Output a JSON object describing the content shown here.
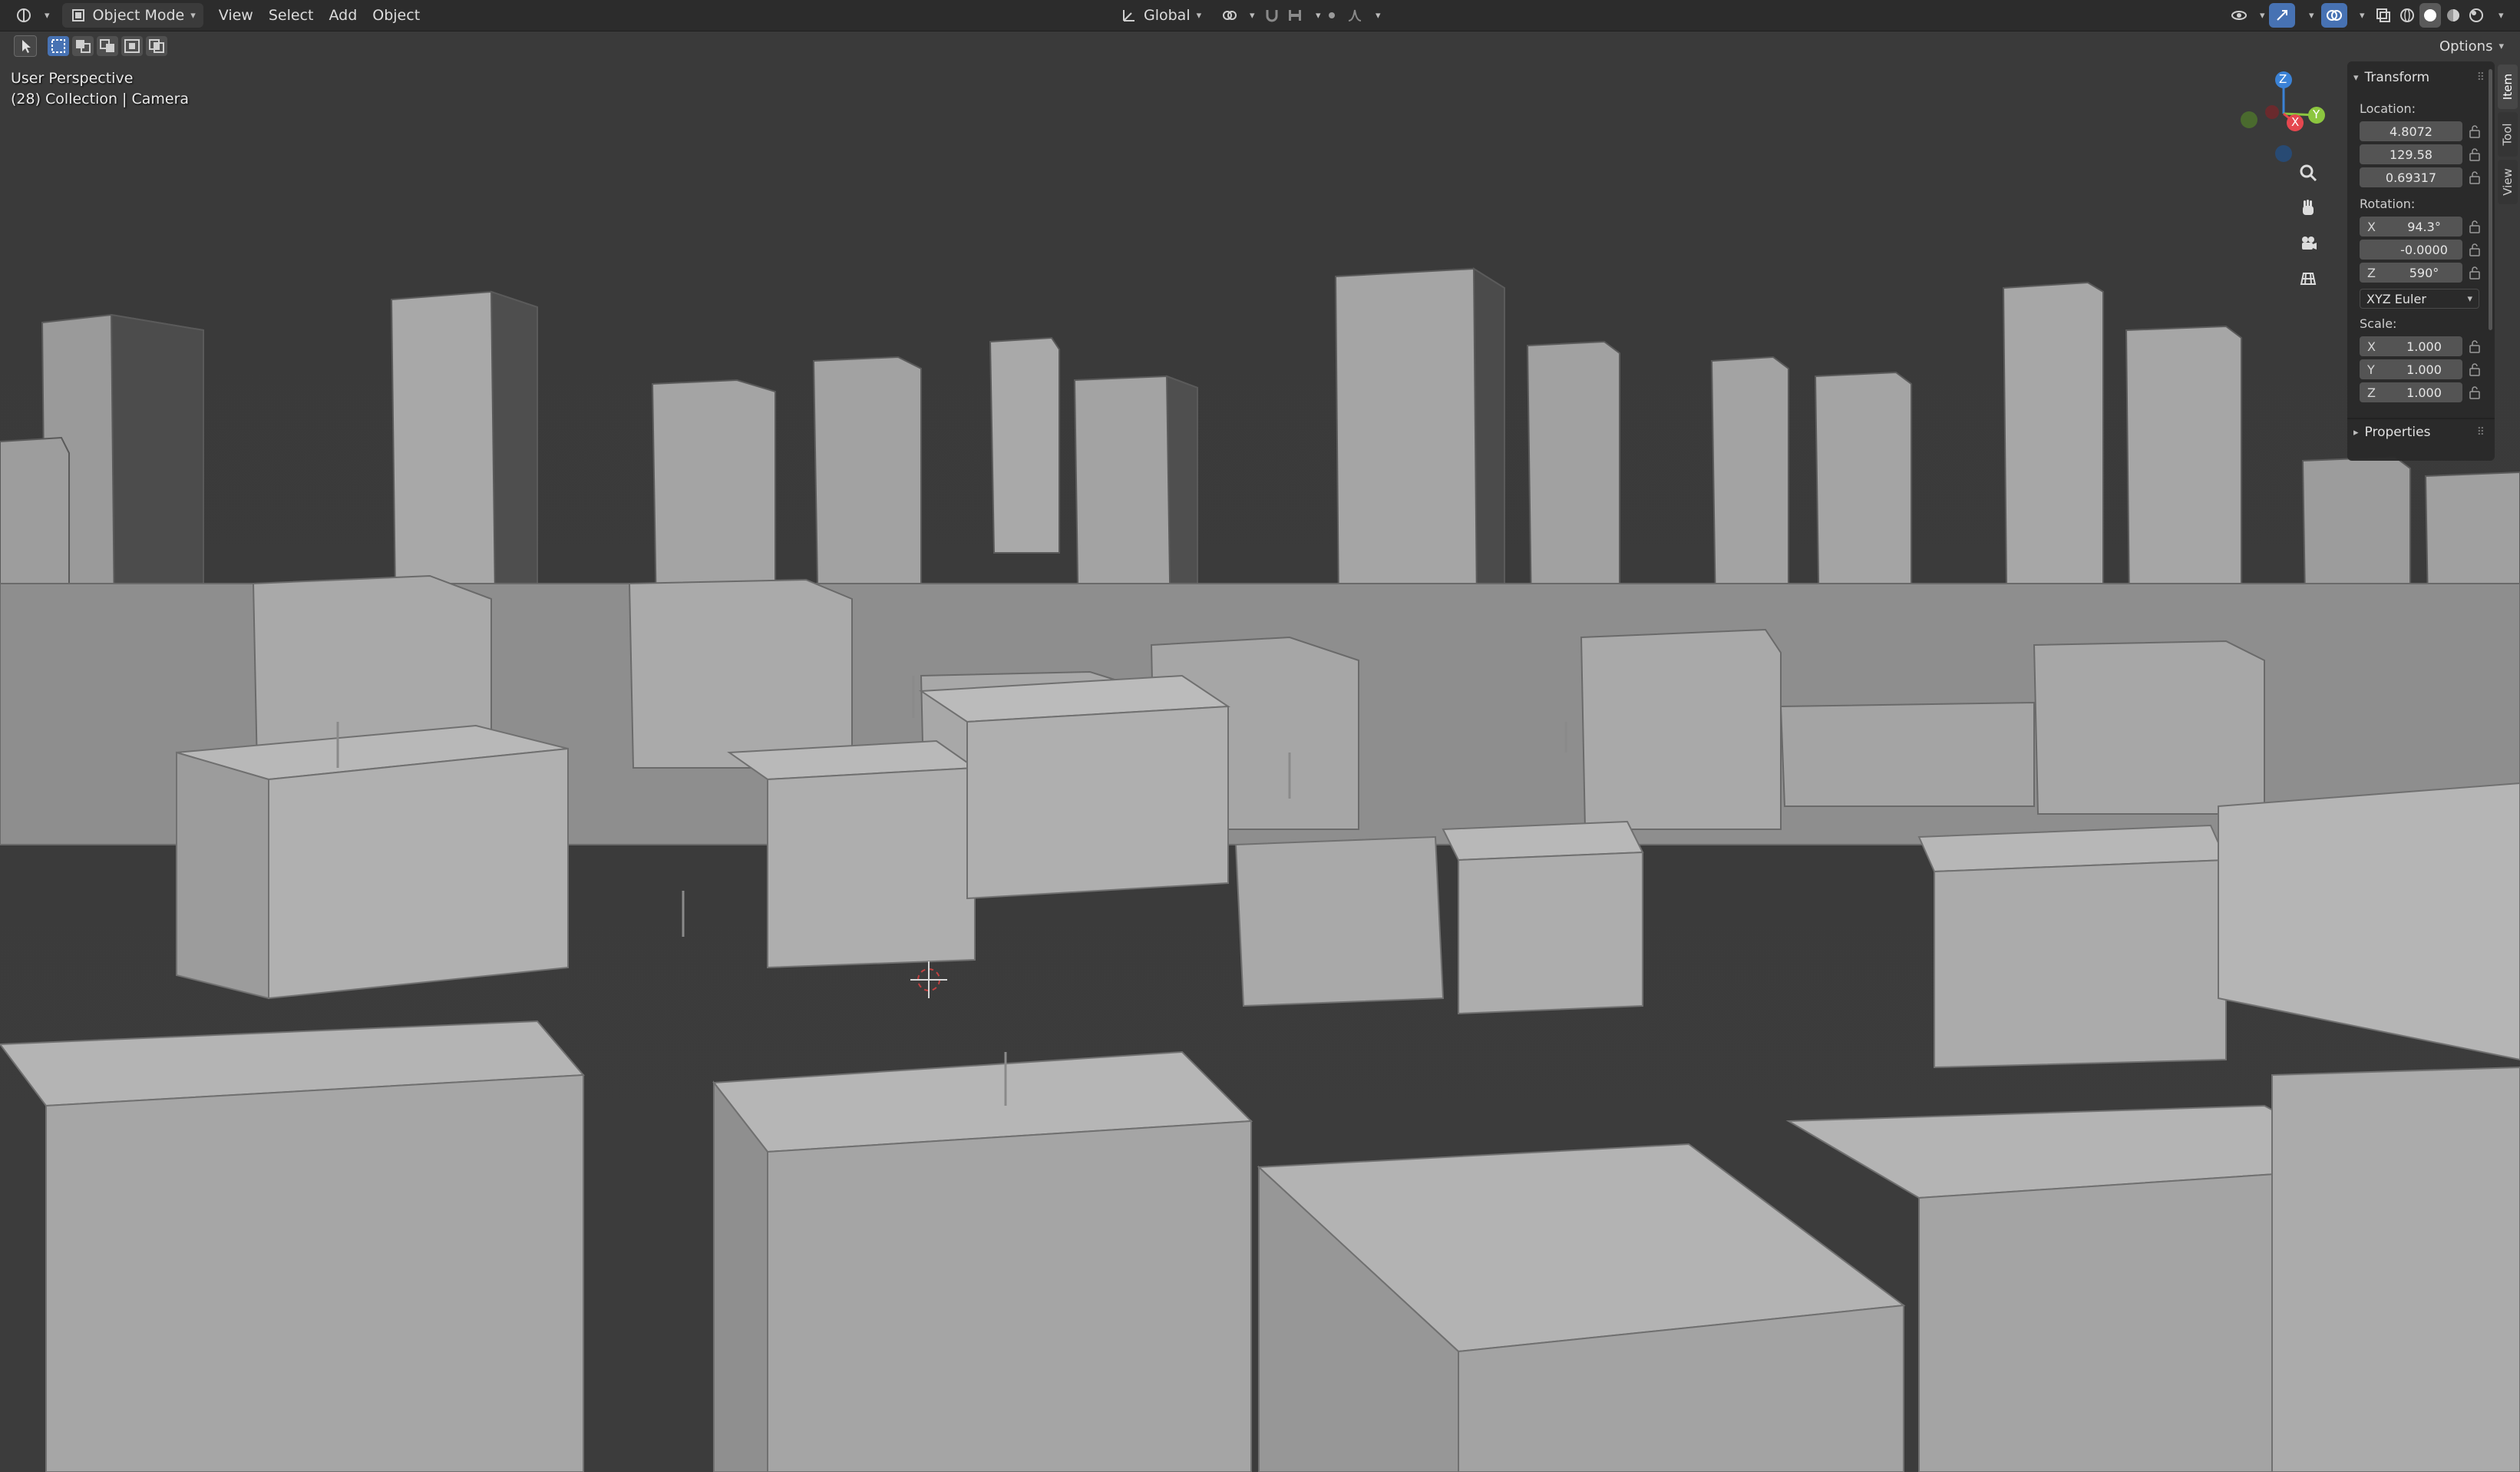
{
  "header": {
    "mode_label": "Object Mode",
    "menus": [
      "View",
      "Select",
      "Add",
      "Object"
    ],
    "transform_orientation": "Global",
    "options_label": "Options"
  },
  "viewport": {
    "perspective_label": "User Perspective",
    "collection_label": "(28) Collection | Camera",
    "gizmo_axes": {
      "x": "X",
      "y": "Y",
      "z": "Z"
    }
  },
  "sidebar": {
    "transform_title": "Transform",
    "location_label": "Location:",
    "location": [
      "4.8072",
      "129.58",
      "0.69317"
    ],
    "rotation_label": "Rotation:",
    "rotation": [
      {
        "axis": "X",
        "value": "94.3°"
      },
      {
        "axis": "",
        "value": "-0.0000"
      },
      {
        "axis": "Z",
        "value": "590°"
      }
    ],
    "rotation_mode": "XYZ Euler",
    "scale_label": "Scale:",
    "scale": [
      {
        "axis": "X",
        "value": "1.000"
      },
      {
        "axis": "Y",
        "value": "1.000"
      },
      {
        "axis": "Z",
        "value": "1.000"
      }
    ],
    "properties_title": "Properties",
    "tabs": [
      "Item",
      "Tool",
      "View"
    ]
  },
  "colors": {
    "axis_x": "#e5474f",
    "axis_y": "#8cc63f",
    "axis_z": "#3b82d6",
    "accent_blue": "#4772b3"
  }
}
